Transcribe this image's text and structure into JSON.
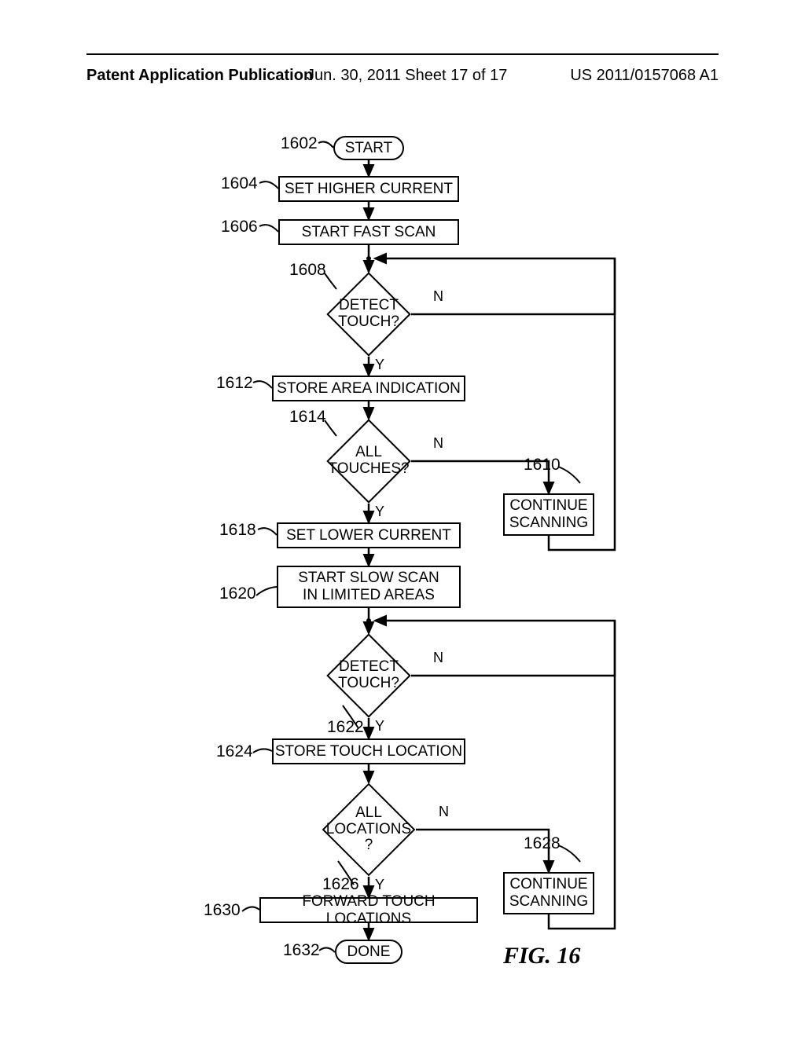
{
  "header": {
    "left": "Patent Application Publication",
    "mid": "Jun. 30, 2011  Sheet 17 of 17",
    "right": "US 2011/0157068 A1"
  },
  "figure_label": "FIG. 16",
  "refs": {
    "r1602": "1602",
    "r1604": "1604",
    "r1606": "1606",
    "r1608": "1608",
    "r1610": "1610",
    "r1612": "1612",
    "r1614": "1614",
    "r1618": "1618",
    "r1620": "1620",
    "r1622": "1622",
    "r1624": "1624",
    "r1626": "1626",
    "r1628": "1628",
    "r1630": "1630",
    "r1632": "1632"
  },
  "nodes": {
    "start": "START",
    "setHigherCurrent": "SET HIGHER CURRENT",
    "startFastScan": "START FAST SCAN",
    "detectTouch1": "DETECT\nTOUCH?",
    "storeAreaIndication": "STORE AREA INDICATION",
    "allTouches": "ALL\nTOUCHES?",
    "continueScanning1": "CONTINUE\nSCANNING",
    "setLowerCurrent": "SET LOWER CURRENT",
    "startSlowScan": "START SLOW SCAN\nIN LIMITED AREAS",
    "detectTouch2": "DETECT\nTOUCH?",
    "storeTouchLocation": "STORE TOUCH LOCATION",
    "allLocations": "ALL\nLOCATIONS\n?",
    "continueScanning2": "CONTINUE\nSCANNING",
    "forwardTouchLocations": "FORWARD TOUCH LOCATIONS",
    "done": "DONE"
  },
  "yn": {
    "y": "Y",
    "n": "N"
  }
}
